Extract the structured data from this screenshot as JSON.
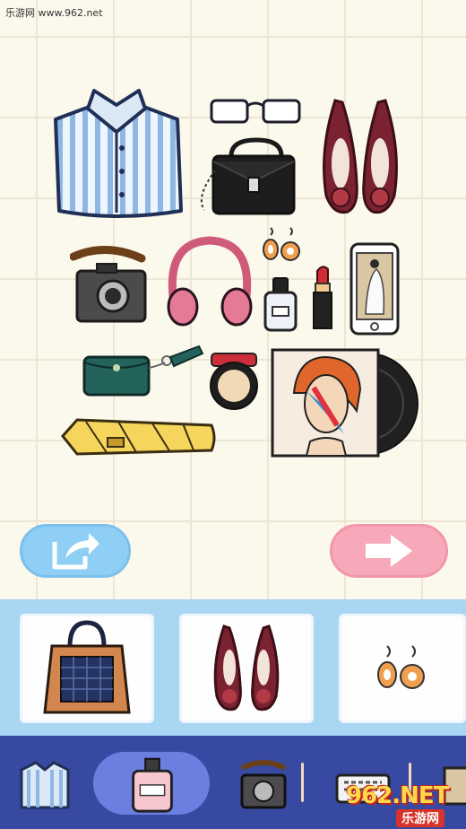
{
  "watermark": "乐游网 www.962.net",
  "colors": {
    "board_bg": "#fbf8ec",
    "share_button": "#8fcff5",
    "next_button": "#f8a9b9",
    "tray_bg": "#a9d6f2",
    "tabbar_bg": "#3849a2",
    "tab_active": "#6a7fe0"
  },
  "board": {
    "items": [
      "striped-shirt",
      "glasses",
      "black-handbag",
      "burgundy-flats",
      "brown-camera",
      "pink-headphones",
      "drop-earrings",
      "perfume-bottle",
      "red-lipstick",
      "smartphone",
      "teal-wallet",
      "compact-powder",
      "vinyl-record-portrait",
      "yellow-umbrella"
    ]
  },
  "buttons": {
    "share_icon": "share-icon",
    "next_icon": "arrow-right-icon"
  },
  "tray": {
    "cards": [
      "tote-bag",
      "burgundy-flats",
      "drop-earrings"
    ]
  },
  "tabs": {
    "items": [
      "shirt",
      "perfume",
      "camera",
      "keyboard",
      "photo"
    ],
    "active": "perfume"
  },
  "logo": {
    "text": "962.NET",
    "sub": "乐游网"
  }
}
